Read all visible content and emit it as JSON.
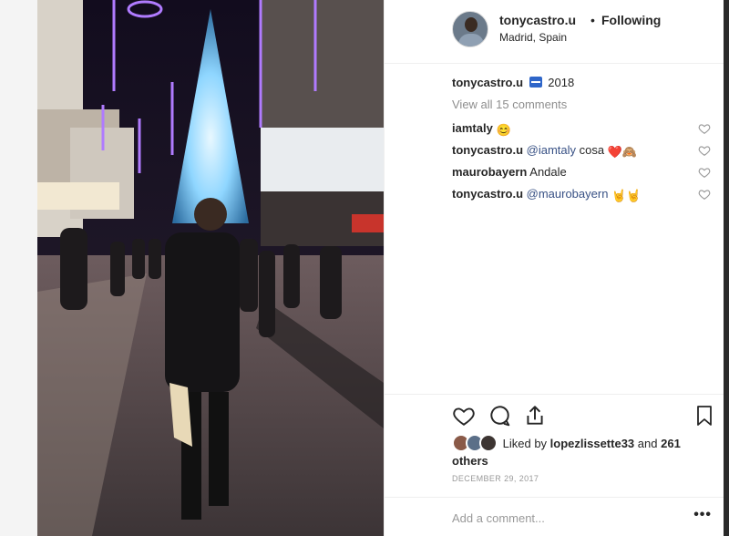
{
  "post": {
    "username": "tonycastro.u",
    "separator": "•",
    "follow_status": "Following",
    "location": "Madrid, Spain",
    "caption_text": "2018",
    "view_all_comments": "View all 15 comments"
  },
  "comments": [
    {
      "user": "iamtaly",
      "mention": "",
      "text": "",
      "emoji": "😊"
    },
    {
      "user": "tonycastro.u",
      "mention": "@iamtaly",
      "text": "cosa",
      "emoji": "❤️🙈"
    },
    {
      "user": "maurobayern",
      "mention": "",
      "text": "Andale",
      "emoji": ""
    },
    {
      "user": "tonycastro.u",
      "mention": "@maurobayern",
      "text": "",
      "emoji": "🤘🤘"
    }
  ],
  "likes": {
    "prefix": "Liked by",
    "user": "lopezlissette33",
    "and": "and",
    "others": "261 others"
  },
  "date": "DECEMBER 29, 2017",
  "add_comment": {
    "placeholder": "Add a comment..."
  },
  "more_label": "•••",
  "icons": [
    "heart-icon",
    "comment-icon",
    "share-icon",
    "bookmark-icon",
    "heart-small-icon",
    "more-icon"
  ],
  "colors": {
    "link": "#385185",
    "text": "#262626",
    "muted": "#8e8e8e",
    "border": "#efefef",
    "purple_lights": "#b07bff"
  }
}
